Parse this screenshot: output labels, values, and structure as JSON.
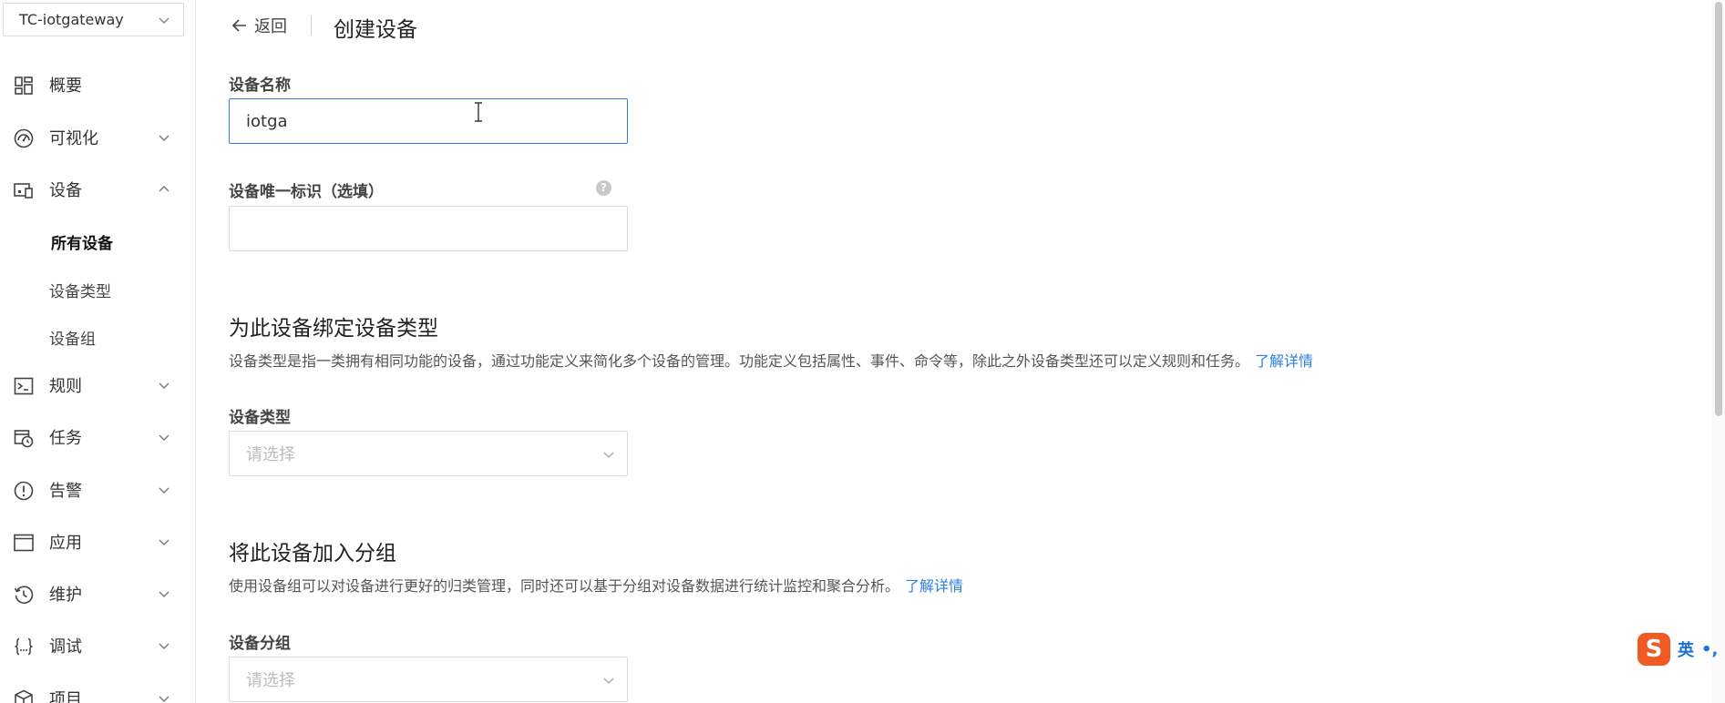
{
  "project": {
    "name": "TC-iotgateway"
  },
  "sidebar": {
    "items": [
      {
        "label": "概要",
        "icon": "dashboard-icon",
        "has_chevron": false
      },
      {
        "label": "可视化",
        "icon": "gauge-icon",
        "has_chevron": true,
        "expanded": false
      },
      {
        "label": "设备",
        "icon": "devices-icon",
        "has_chevron": true,
        "expanded": true
      },
      {
        "label": "规则",
        "icon": "terminal-icon",
        "has_chevron": true,
        "expanded": false
      },
      {
        "label": "任务",
        "icon": "calendar-clock-icon",
        "has_chevron": true,
        "expanded": false
      },
      {
        "label": "告警",
        "icon": "alert-icon",
        "has_chevron": true,
        "expanded": false
      },
      {
        "label": "应用",
        "icon": "window-icon",
        "has_chevron": true,
        "expanded": false
      },
      {
        "label": "维护",
        "icon": "history-icon",
        "has_chevron": true,
        "expanded": false
      },
      {
        "label": "调试",
        "icon": "code-braces-icon",
        "has_chevron": true,
        "expanded": false
      },
      {
        "label": "项目",
        "icon": "cube-icon",
        "has_chevron": true,
        "expanded": false
      }
    ],
    "device_subitems": [
      {
        "label": "所有设备",
        "active": true
      },
      {
        "label": "设备类型",
        "active": false
      },
      {
        "label": "设备组",
        "active": false
      }
    ]
  },
  "header": {
    "back_label": "返回",
    "title": "创建设备"
  },
  "form": {
    "device_name": {
      "label": "设备名称",
      "value": "iotga"
    },
    "device_id": {
      "label": "设备唯一标识（选填）",
      "value": "",
      "help_icon": "?"
    },
    "bind_type_section": {
      "title": "为此设备绑定设备类型",
      "description": "设备类型是指一类拥有相同功能的设备，通过功能定义来简化多个设备的管理。功能定义包括属性、事件、命令等，除此之外设备类型还可以定义规则和任务。",
      "link": "了解详情"
    },
    "device_type": {
      "label": "设备类型",
      "placeholder": "请选择"
    },
    "group_section": {
      "title": "将此设备加入分组",
      "description": "使用设备组可以对设备进行更好的归类管理，同时还可以基于分组对设备数据进行统计监控和聚合分析。",
      "link": "了解详情"
    },
    "device_group": {
      "label": "设备分组",
      "placeholder": "请选择"
    }
  },
  "ime": {
    "logo": "S",
    "mode": "英",
    "punct": "•,"
  },
  "colors": {
    "accent": "#2b7fe0",
    "ime_brand": "#f15a22"
  }
}
